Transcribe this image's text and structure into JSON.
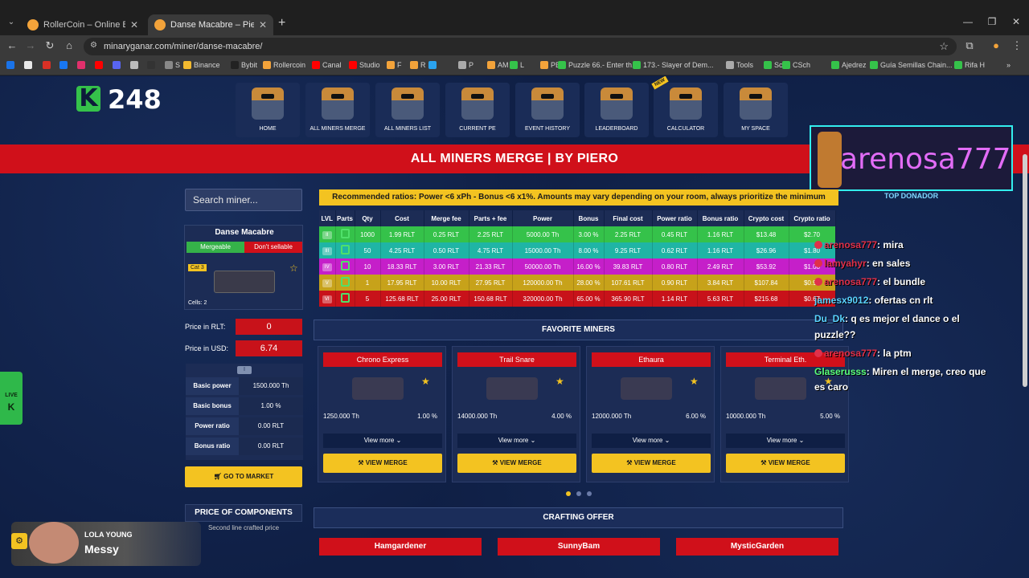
{
  "browser": {
    "tabs": [
      {
        "title": "RollerCoin – Online Bitcoin Mi",
        "active": false,
        "favicon_color": "#f3a33a"
      },
      {
        "title": "Danse Macabre – Piero",
        "active": true,
        "favicon_color": "#f3a33a"
      }
    ],
    "url": "minaryganar.com/miner/danse-macabre/",
    "bookmarks": [
      {
        "label": "",
        "color": "#1a73e8"
      },
      {
        "label": "",
        "color": "#e8e8e8"
      },
      {
        "label": "",
        "color": "#d93025"
      },
      {
        "label": "",
        "color": "#1877f2"
      },
      {
        "label": "",
        "color": "#e1306c"
      },
      {
        "label": "",
        "color": "#ff0000"
      },
      {
        "label": "",
        "color": "#5865f2"
      },
      {
        "label": "",
        "color": "#bbbbbb"
      },
      {
        "label": "",
        "color": "#333333"
      },
      {
        "label": "S",
        "color": "#888888"
      },
      {
        "label": "Binance",
        "color": "#f3ba2f"
      },
      {
        "label": "Bybit",
        "color": "#222222"
      },
      {
        "label": "Rollercoin",
        "color": "#f3a33a"
      },
      {
        "label": "Canal",
        "color": "#ff0000"
      },
      {
        "label": "Studio",
        "color": "#ff0000"
      },
      {
        "label": "F",
        "color": "#f3a33a"
      },
      {
        "label": "R",
        "color": "#f3a33a"
      },
      {
        "label": "",
        "color": "#2aa3ef"
      },
      {
        "label": "P",
        "color": "#aaaaaa"
      },
      {
        "label": "AM",
        "color": "#f3a33a"
      },
      {
        "label": "L",
        "color": "#35c24a"
      },
      {
        "label": "PE",
        "color": "#f3a33a"
      },
      {
        "label": "Puzzle 66.- Enter th...",
        "color": "#35c24a"
      },
      {
        "label": "173.- Slayer of Dem...",
        "color": "#35c24a"
      },
      {
        "label": "Tools",
        "color": "#aaaaaa"
      },
      {
        "label": "Sch",
        "color": "#35c24a"
      },
      {
        "label": "CSch",
        "color": "#35c24a"
      },
      {
        "label": "Ajedrez",
        "color": "#35c24a"
      },
      {
        "label": "Guía Semillas Chain...",
        "color": "#35c24a"
      },
      {
        "label": "Rifa H",
        "color": "#35c24a"
      }
    ]
  },
  "header": {
    "k_count": "248",
    "nav": [
      {
        "label": "HOME"
      },
      {
        "label": "ALL MINERS MERGE"
      },
      {
        "label": "ALL MINERS LIST"
      },
      {
        "label": "CURRENT PE"
      },
      {
        "label": "EVENT HISTORY"
      },
      {
        "label": "LEADERBOARD"
      },
      {
        "label": "CALCULATOR",
        "badge": "NEW"
      },
      {
        "label": "MY SPACE"
      }
    ],
    "banner": "ALL MINERS MERGE | BY PIERO"
  },
  "streamer": {
    "name": "arenosa777",
    "subtitle": "TOP DONADOR"
  },
  "sidebar": {
    "search_placeholder": "Search miner...",
    "miner": {
      "name": "Danse Macabre",
      "tag_merge": "Mergeable",
      "tag_sell": "Don't sellable",
      "category": "Cat 3",
      "cells": "Cells: 2"
    },
    "price_rlt_label": "Price in RLT:",
    "price_rlt": "0",
    "price_usd_label": "Price in USD:",
    "price_usd": "6.74",
    "stats": [
      {
        "k": "Basic power",
        "v": "1500.000 Th"
      },
      {
        "k": "Basic bonus",
        "v": "1.00 %"
      },
      {
        "k": "Power ratio",
        "v": "0.00 RLT"
      },
      {
        "k": "Bonus ratio",
        "v": "0.00 RLT"
      }
    ],
    "market_button": "GO TO MARKET",
    "components_title": "PRICE OF COMPONENTS",
    "components_sub": "Second line crafted price"
  },
  "ratios": {
    "note": "Recommended ratios: Power <6 xPh - Bonus <6 x1%. Amounts may vary depending on your room, always prioritize the minimum",
    "headers": [
      "LVL",
      "Parts",
      "Qty",
      "Cost",
      "Merge fee",
      "Parts + fee",
      "Power",
      "Bonus",
      "Final cost",
      "Power ratio",
      "Bonus ratio",
      "Crypto cost",
      "Crypto ratio"
    ],
    "rows": [
      {
        "lvl": "II",
        "color": "#35c24a",
        "qty": "1000",
        "cost": "1.99 RLT",
        "merge": "0.25 RLT",
        "partsfee": "2.25 RLT",
        "power": "5000.00 Th",
        "bonus": "3.00 %",
        "final": "2.25 RLT",
        "pratio": "0.45 RLT",
        "bratio": "1.16 RLT",
        "ccost": "$13.48",
        "cratio": "$2.70"
      },
      {
        "lvl": "III",
        "color": "#1fb5a5",
        "qty": "50",
        "cost": "4.25 RLT",
        "merge": "0.50 RLT",
        "partsfee": "4.75 RLT",
        "power": "15000.00 Th",
        "bonus": "8.00 %",
        "final": "9.25 RLT",
        "pratio": "0.62 RLT",
        "bratio": "1.16 RLT",
        "ccost": "$26.96",
        "cratio": "$1.80"
      },
      {
        "lvl": "IV",
        "color": "#c51fc9",
        "qty": "10",
        "cost": "18.33 RLT",
        "merge": "3.00 RLT",
        "partsfee": "21.33 RLT",
        "power": "50000.00 Th",
        "bonus": "16.00 %",
        "final": "39.83 RLT",
        "pratio": "0.80 RLT",
        "bratio": "2.49 RLT",
        "ccost": "$53.92",
        "cratio": "$1.08"
      },
      {
        "lvl": "V",
        "color": "#c7a21a",
        "qty": "1",
        "cost": "17.95 RLT",
        "merge": "10.00 RLT",
        "partsfee": "27.95 RLT",
        "power": "120000.00 Th",
        "bonus": "28.00 %",
        "final": "107.61 RLT",
        "pratio": "0.90 RLT",
        "bratio": "3.84 RLT",
        "ccost": "$107.84",
        "cratio": "$0.90"
      },
      {
        "lvl": "VI",
        "color": "#c8121a",
        "qty": "5",
        "cost": "125.68 RLT",
        "merge": "25.00 RLT",
        "partsfee": "150.68 RLT",
        "power": "320000.00 Th",
        "bonus": "65.00 %",
        "final": "365.90 RLT",
        "pratio": "1.14 RLT",
        "bratio": "5.63 RLT",
        "ccost": "$215.68",
        "cratio": "$0.67"
      }
    ]
  },
  "favorites": {
    "title": "FAVORITE MINERS",
    "cards": [
      {
        "name": "Chrono Express",
        "power": "1250.000 Th",
        "bonus": "1.00 %",
        "view_more": "View more",
        "view_merge": "VIEW MERGE"
      },
      {
        "name": "Trail Snare",
        "power": "14000.000 Th",
        "bonus": "4.00 %",
        "view_more": "View more",
        "view_merge": "VIEW MERGE"
      },
      {
        "name": "Ethaura",
        "power": "12000.000 Th",
        "bonus": "6.00 %",
        "view_more": "View more",
        "view_merge": "VIEW MERGE"
      },
      {
        "name": "Terminal Eth.",
        "power": "10000.000 Th",
        "bonus": "5.00 %",
        "view_more": "View more",
        "view_merge": "VIEW MERGE"
      }
    ]
  },
  "crafting": {
    "title": "CRAFTING OFFER",
    "cards": [
      {
        "name": "Hamgardener"
      },
      {
        "name": "SunnyBam"
      },
      {
        "name": "MysticGarden"
      }
    ]
  },
  "chat": [
    {
      "user": "arenosa777",
      "msg": ": mira",
      "color": "#e0304a"
    },
    {
      "user": "lamyahyr",
      "msg": ": en sales",
      "color": "#e0304a"
    },
    {
      "user": "arenosa777",
      "msg": ": el bundle",
      "color": "#e0304a"
    },
    {
      "user": "jamesx9012",
      "msg": ": ofertas cn rlt",
      "color": "#5ad3ff"
    },
    {
      "user": "Du_Dk",
      "msg": ": q es mejor el dance o el",
      "color": "#5ad3ff"
    },
    {
      "user": "",
      "msg": "puzzle??",
      "color": "#ffffff"
    },
    {
      "user": "arenosa777",
      "msg": ": la ptm",
      "color": "#e0304a"
    },
    {
      "user": "Glaserusss",
      "msg": ": Miren el merge, creo que",
      "color": "#5aff7a"
    },
    {
      "user": "",
      "msg": "es caro",
      "color": "#ffffff"
    }
  ],
  "live_tab": "LIVE",
  "now_playing": {
    "artist": "LOLA YOUNG",
    "song": "Messy"
  }
}
